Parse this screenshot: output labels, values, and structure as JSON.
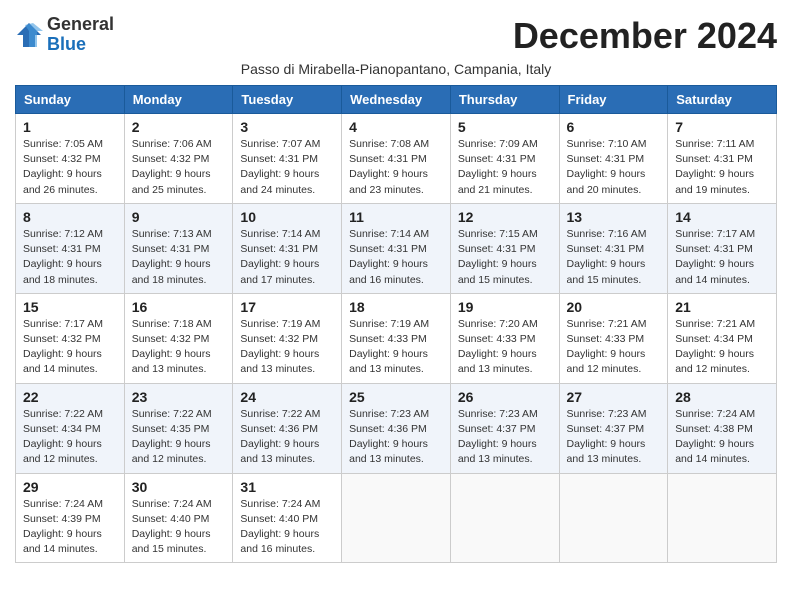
{
  "header": {
    "logo_general": "General",
    "logo_blue": "Blue",
    "month_title": "December 2024",
    "subtitle": "Passo di Mirabella-Pianopantano, Campania, Italy"
  },
  "columns": [
    "Sunday",
    "Monday",
    "Tuesday",
    "Wednesday",
    "Thursday",
    "Friday",
    "Saturday"
  ],
  "weeks": [
    [
      {
        "day": "1",
        "sunrise": "Sunrise: 7:05 AM",
        "sunset": "Sunset: 4:32 PM",
        "daylight": "Daylight: 9 hours and 26 minutes."
      },
      {
        "day": "2",
        "sunrise": "Sunrise: 7:06 AM",
        "sunset": "Sunset: 4:32 PM",
        "daylight": "Daylight: 9 hours and 25 minutes."
      },
      {
        "day": "3",
        "sunrise": "Sunrise: 7:07 AM",
        "sunset": "Sunset: 4:31 PM",
        "daylight": "Daylight: 9 hours and 24 minutes."
      },
      {
        "day": "4",
        "sunrise": "Sunrise: 7:08 AM",
        "sunset": "Sunset: 4:31 PM",
        "daylight": "Daylight: 9 hours and 23 minutes."
      },
      {
        "day": "5",
        "sunrise": "Sunrise: 7:09 AM",
        "sunset": "Sunset: 4:31 PM",
        "daylight": "Daylight: 9 hours and 21 minutes."
      },
      {
        "day": "6",
        "sunrise": "Sunrise: 7:10 AM",
        "sunset": "Sunset: 4:31 PM",
        "daylight": "Daylight: 9 hours and 20 minutes."
      },
      {
        "day": "7",
        "sunrise": "Sunrise: 7:11 AM",
        "sunset": "Sunset: 4:31 PM",
        "daylight": "Daylight: 9 hours and 19 minutes."
      }
    ],
    [
      {
        "day": "8",
        "sunrise": "Sunrise: 7:12 AM",
        "sunset": "Sunset: 4:31 PM",
        "daylight": "Daylight: 9 hours and 18 minutes."
      },
      {
        "day": "9",
        "sunrise": "Sunrise: 7:13 AM",
        "sunset": "Sunset: 4:31 PM",
        "daylight": "Daylight: 9 hours and 18 minutes."
      },
      {
        "day": "10",
        "sunrise": "Sunrise: 7:14 AM",
        "sunset": "Sunset: 4:31 PM",
        "daylight": "Daylight: 9 hours and 17 minutes."
      },
      {
        "day": "11",
        "sunrise": "Sunrise: 7:14 AM",
        "sunset": "Sunset: 4:31 PM",
        "daylight": "Daylight: 9 hours and 16 minutes."
      },
      {
        "day": "12",
        "sunrise": "Sunrise: 7:15 AM",
        "sunset": "Sunset: 4:31 PM",
        "daylight": "Daylight: 9 hours and 15 minutes."
      },
      {
        "day": "13",
        "sunrise": "Sunrise: 7:16 AM",
        "sunset": "Sunset: 4:31 PM",
        "daylight": "Daylight: 9 hours and 15 minutes."
      },
      {
        "day": "14",
        "sunrise": "Sunrise: 7:17 AM",
        "sunset": "Sunset: 4:31 PM",
        "daylight": "Daylight: 9 hours and 14 minutes."
      }
    ],
    [
      {
        "day": "15",
        "sunrise": "Sunrise: 7:17 AM",
        "sunset": "Sunset: 4:32 PM",
        "daylight": "Daylight: 9 hours and 14 minutes."
      },
      {
        "day": "16",
        "sunrise": "Sunrise: 7:18 AM",
        "sunset": "Sunset: 4:32 PM",
        "daylight": "Daylight: 9 hours and 13 minutes."
      },
      {
        "day": "17",
        "sunrise": "Sunrise: 7:19 AM",
        "sunset": "Sunset: 4:32 PM",
        "daylight": "Daylight: 9 hours and 13 minutes."
      },
      {
        "day": "18",
        "sunrise": "Sunrise: 7:19 AM",
        "sunset": "Sunset: 4:33 PM",
        "daylight": "Daylight: 9 hours and 13 minutes."
      },
      {
        "day": "19",
        "sunrise": "Sunrise: 7:20 AM",
        "sunset": "Sunset: 4:33 PM",
        "daylight": "Daylight: 9 hours and 13 minutes."
      },
      {
        "day": "20",
        "sunrise": "Sunrise: 7:21 AM",
        "sunset": "Sunset: 4:33 PM",
        "daylight": "Daylight: 9 hours and 12 minutes."
      },
      {
        "day": "21",
        "sunrise": "Sunrise: 7:21 AM",
        "sunset": "Sunset: 4:34 PM",
        "daylight": "Daylight: 9 hours and 12 minutes."
      }
    ],
    [
      {
        "day": "22",
        "sunrise": "Sunrise: 7:22 AM",
        "sunset": "Sunset: 4:34 PM",
        "daylight": "Daylight: 9 hours and 12 minutes."
      },
      {
        "day": "23",
        "sunrise": "Sunrise: 7:22 AM",
        "sunset": "Sunset: 4:35 PM",
        "daylight": "Daylight: 9 hours and 12 minutes."
      },
      {
        "day": "24",
        "sunrise": "Sunrise: 7:22 AM",
        "sunset": "Sunset: 4:36 PM",
        "daylight": "Daylight: 9 hours and 13 minutes."
      },
      {
        "day": "25",
        "sunrise": "Sunrise: 7:23 AM",
        "sunset": "Sunset: 4:36 PM",
        "daylight": "Daylight: 9 hours and 13 minutes."
      },
      {
        "day": "26",
        "sunrise": "Sunrise: 7:23 AM",
        "sunset": "Sunset: 4:37 PM",
        "daylight": "Daylight: 9 hours and 13 minutes."
      },
      {
        "day": "27",
        "sunrise": "Sunrise: 7:23 AM",
        "sunset": "Sunset: 4:37 PM",
        "daylight": "Daylight: 9 hours and 13 minutes."
      },
      {
        "day": "28",
        "sunrise": "Sunrise: 7:24 AM",
        "sunset": "Sunset: 4:38 PM",
        "daylight": "Daylight: 9 hours and 14 minutes."
      }
    ],
    [
      {
        "day": "29",
        "sunrise": "Sunrise: 7:24 AM",
        "sunset": "Sunset: 4:39 PM",
        "daylight": "Daylight: 9 hours and 14 minutes."
      },
      {
        "day": "30",
        "sunrise": "Sunrise: 7:24 AM",
        "sunset": "Sunset: 4:40 PM",
        "daylight": "Daylight: 9 hours and 15 minutes."
      },
      {
        "day": "31",
        "sunrise": "Sunrise: 7:24 AM",
        "sunset": "Sunset: 4:40 PM",
        "daylight": "Daylight: 9 hours and 16 minutes."
      },
      null,
      null,
      null,
      null
    ]
  ]
}
